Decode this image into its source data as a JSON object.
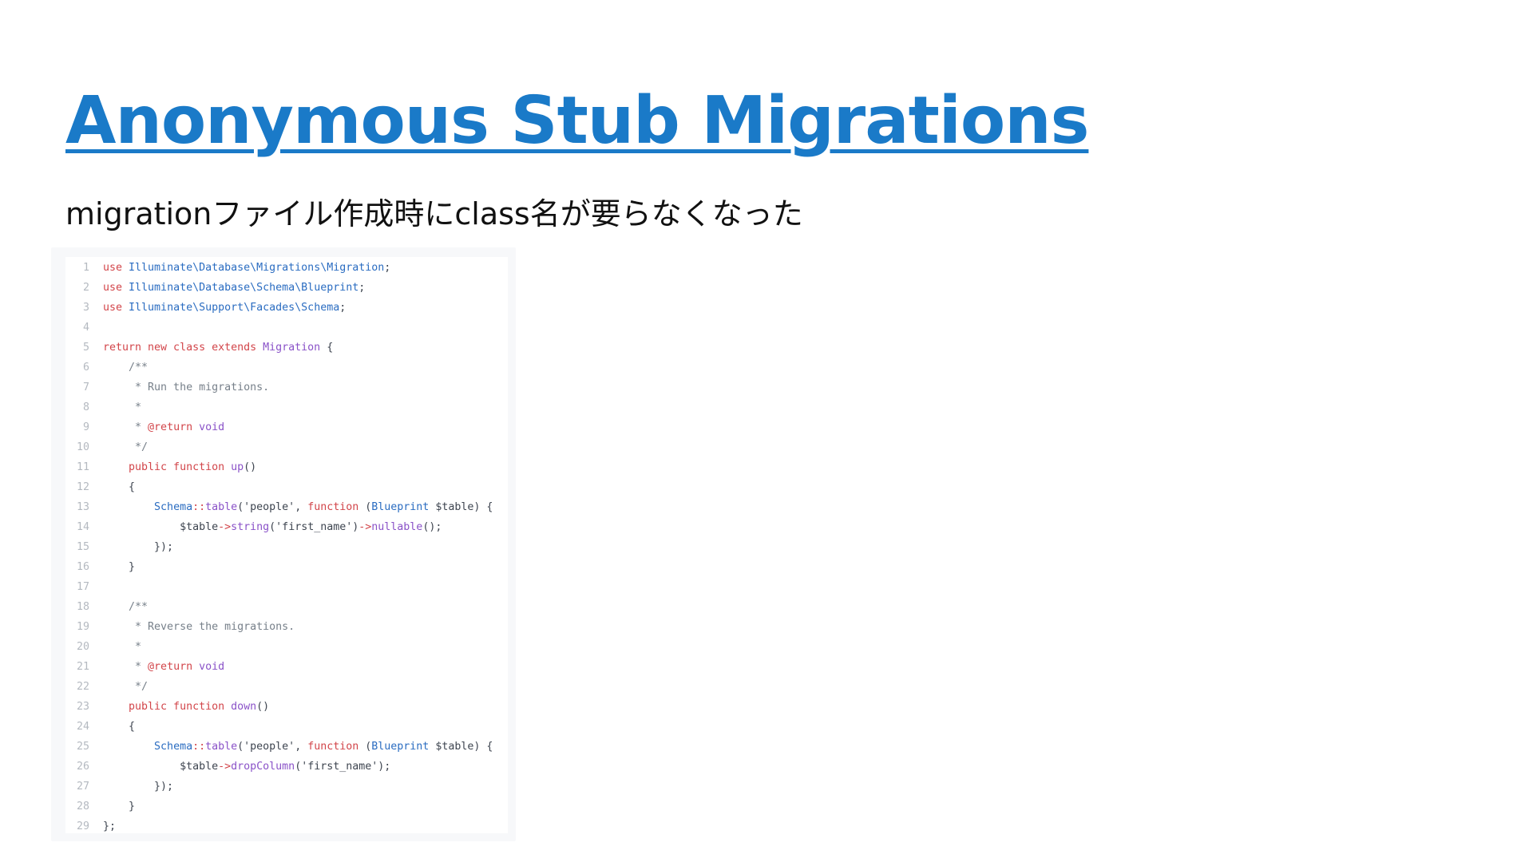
{
  "slide": {
    "title": "Anonymous Stub Migrations",
    "subtitle": "migrationファイル作成時にclass名が要らなくなった"
  },
  "colors": {
    "title": "#1a7ac8",
    "keyword": "#d2454a",
    "type": "#2a6cc1",
    "function": "#8a52c8",
    "comment": "#77808a",
    "plain": "#3e4550",
    "line_number": "#b4b9c0"
  },
  "code": {
    "lines": [
      {
        "number": "1",
        "tokens": [
          {
            "t": "use ",
            "k": "keyword"
          },
          {
            "t": "Illuminate\\Database\\Migrations\\Migration",
            "k": "type"
          },
          {
            "t": ";",
            "k": "plain"
          }
        ]
      },
      {
        "number": "2",
        "tokens": [
          {
            "t": "use ",
            "k": "keyword"
          },
          {
            "t": "Illuminate\\Database\\Schema\\Blueprint",
            "k": "type"
          },
          {
            "t": ";",
            "k": "plain"
          }
        ]
      },
      {
        "number": "3",
        "tokens": [
          {
            "t": "use ",
            "k": "keyword"
          },
          {
            "t": "Illuminate\\Support\\Facades\\Schema",
            "k": "type"
          },
          {
            "t": ";",
            "k": "plain"
          }
        ]
      },
      {
        "number": "4",
        "tokens": []
      },
      {
        "number": "5",
        "tokens": [
          {
            "t": "return new class extends ",
            "k": "keyword"
          },
          {
            "t": "Migration",
            "k": "func"
          },
          {
            "t": " {",
            "k": "plain"
          }
        ]
      },
      {
        "number": "6",
        "tokens": [
          {
            "t": "    /**",
            "k": "comment"
          }
        ]
      },
      {
        "number": "7",
        "tokens": [
          {
            "t": "     * Run the migrations.",
            "k": "comment"
          }
        ]
      },
      {
        "number": "8",
        "tokens": [
          {
            "t": "     *",
            "k": "comment"
          }
        ]
      },
      {
        "number": "9",
        "tokens": [
          {
            "t": "     * ",
            "k": "comment"
          },
          {
            "t": "@return",
            "k": "keyword"
          },
          {
            "t": " void",
            "k": "func"
          }
        ]
      },
      {
        "number": "10",
        "tokens": [
          {
            "t": "     */",
            "k": "comment"
          }
        ]
      },
      {
        "number": "11",
        "tokens": [
          {
            "t": "    public function ",
            "k": "keyword"
          },
          {
            "t": "up",
            "k": "func"
          },
          {
            "t": "()",
            "k": "plain"
          }
        ]
      },
      {
        "number": "12",
        "tokens": [
          {
            "t": "    {",
            "k": "plain"
          }
        ]
      },
      {
        "number": "13",
        "tokens": [
          {
            "t": "        ",
            "k": "plain"
          },
          {
            "t": "Schema",
            "k": "type"
          },
          {
            "t": "::",
            "k": "keyword"
          },
          {
            "t": "table",
            "k": "func"
          },
          {
            "t": "('people', ",
            "k": "plain"
          },
          {
            "t": "function",
            "k": "keyword"
          },
          {
            "t": " (",
            "k": "plain"
          },
          {
            "t": "Blueprint",
            "k": "type"
          },
          {
            "t": " $table) {",
            "k": "plain"
          }
        ]
      },
      {
        "number": "14",
        "tokens": [
          {
            "t": "            $table",
            "k": "plain"
          },
          {
            "t": "->",
            "k": "keyword"
          },
          {
            "t": "string",
            "k": "func"
          },
          {
            "t": "('first_name')",
            "k": "plain"
          },
          {
            "t": "->",
            "k": "keyword"
          },
          {
            "t": "nullable",
            "k": "func"
          },
          {
            "t": "();",
            "k": "plain"
          }
        ]
      },
      {
        "number": "15",
        "tokens": [
          {
            "t": "        });",
            "k": "plain"
          }
        ]
      },
      {
        "number": "16",
        "tokens": [
          {
            "t": "    }",
            "k": "plain"
          }
        ]
      },
      {
        "number": "17",
        "tokens": []
      },
      {
        "number": "18",
        "tokens": [
          {
            "t": "    /**",
            "k": "comment"
          }
        ]
      },
      {
        "number": "19",
        "tokens": [
          {
            "t": "     * Reverse the migrations.",
            "k": "comment"
          }
        ]
      },
      {
        "number": "20",
        "tokens": [
          {
            "t": "     *",
            "k": "comment"
          }
        ]
      },
      {
        "number": "21",
        "tokens": [
          {
            "t": "     * ",
            "k": "comment"
          },
          {
            "t": "@return",
            "k": "keyword"
          },
          {
            "t": " void",
            "k": "func"
          }
        ]
      },
      {
        "number": "22",
        "tokens": [
          {
            "t": "     */",
            "k": "comment"
          }
        ]
      },
      {
        "number": "23",
        "tokens": [
          {
            "t": "    public function ",
            "k": "keyword"
          },
          {
            "t": "down",
            "k": "func"
          },
          {
            "t": "()",
            "k": "plain"
          }
        ]
      },
      {
        "number": "24",
        "tokens": [
          {
            "t": "    {",
            "k": "plain"
          }
        ]
      },
      {
        "number": "25",
        "tokens": [
          {
            "t": "        ",
            "k": "plain"
          },
          {
            "t": "Schema",
            "k": "type"
          },
          {
            "t": "::",
            "k": "keyword"
          },
          {
            "t": "table",
            "k": "func"
          },
          {
            "t": "('people', ",
            "k": "plain"
          },
          {
            "t": "function",
            "k": "keyword"
          },
          {
            "t": " (",
            "k": "plain"
          },
          {
            "t": "Blueprint",
            "k": "type"
          },
          {
            "t": " $table) {",
            "k": "plain"
          }
        ]
      },
      {
        "number": "26",
        "tokens": [
          {
            "t": "            $table",
            "k": "plain"
          },
          {
            "t": "->",
            "k": "keyword"
          },
          {
            "t": "dropColumn",
            "k": "func"
          },
          {
            "t": "('first_name');",
            "k": "plain"
          }
        ]
      },
      {
        "number": "27",
        "tokens": [
          {
            "t": "        });",
            "k": "plain"
          }
        ]
      },
      {
        "number": "28",
        "tokens": [
          {
            "t": "    }",
            "k": "plain"
          }
        ]
      },
      {
        "number": "29",
        "tokens": [
          {
            "t": "};",
            "k": "plain"
          }
        ]
      }
    ]
  }
}
